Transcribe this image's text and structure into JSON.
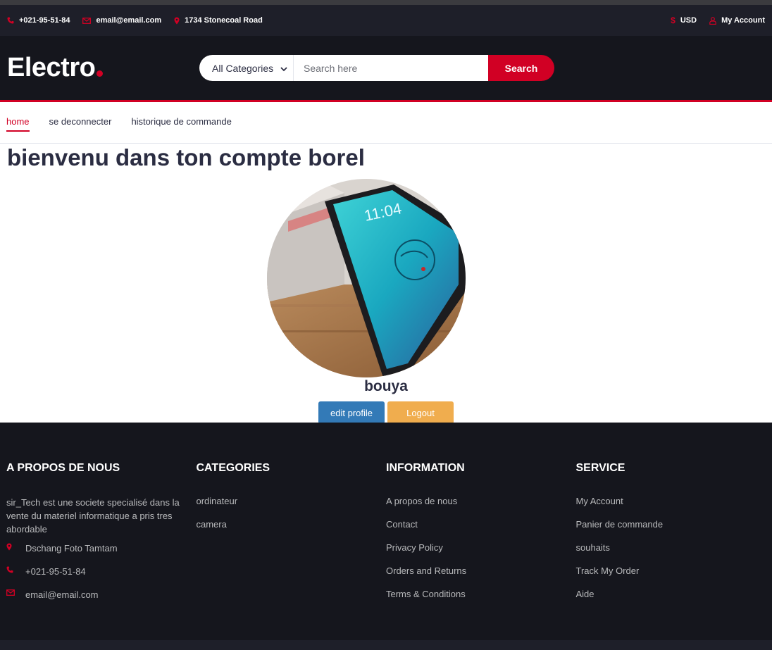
{
  "topbar": {
    "phone": "+021-95-51-84",
    "email": "email@email.com",
    "address": "1734 Stonecoal Road",
    "currency": "USD",
    "account": "My Account"
  },
  "header": {
    "logo": "Electro",
    "category_selected": "All Categories",
    "search_placeholder": "Search here",
    "search_button": "Search"
  },
  "nav": {
    "items": [
      "home",
      "se deconnecter",
      "historique de commande"
    ]
  },
  "main": {
    "welcome": "bienvenu dans ton compte borel",
    "username": "bouya",
    "edit_button": "edit profile",
    "logout_button": "Logout"
  },
  "footer": {
    "about": {
      "title": "A PROPOS DE NOUS",
      "text": "sir_Tech est une societe specialisé dans la vente du materiel informatique a pris tres abordable",
      "address": "Dschang Foto Tamtam",
      "phone": "+021-95-51-84",
      "email": "email@email.com"
    },
    "categories": {
      "title": "CATEGORIES",
      "items": [
        "ordinateur",
        "camera"
      ]
    },
    "information": {
      "title": "INFORMATION",
      "items": [
        "A propos de nous",
        "Contact",
        "Privacy Policy",
        "Orders and Returns",
        "Terms & Conditions"
      ]
    },
    "service": {
      "title": "SERVICE",
      "items": [
        "My Account",
        "Panier de commande",
        "souhaits",
        "Track My Order",
        "Aide"
      ]
    }
  },
  "colors": {
    "accent": "#d10024",
    "header_bg": "#15161d",
    "topbar_bg": "#1e1f29",
    "edit_btn": "#337ab7",
    "logout_btn": "#f0ad4e"
  }
}
